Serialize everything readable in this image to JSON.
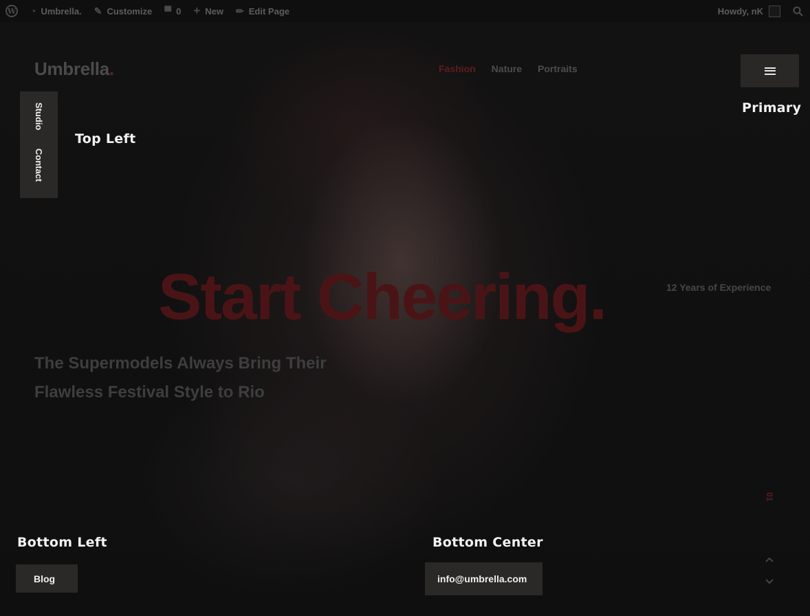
{
  "adminbar": {
    "wp_icon": "wordpress-icon",
    "site_name": "Umbrella.",
    "customize": "Customize",
    "comments_count": "0",
    "new": "New",
    "edit_page": "Edit Page",
    "howdy": "Howdy, nK"
  },
  "header": {
    "logo_text": "Umbrella",
    "logo_dot": ".",
    "nav": [
      "Fashion",
      "Nature",
      "Portraits"
    ],
    "menu_icon": "hamburger-icon"
  },
  "widgets": {
    "primary": "Primary",
    "top_left": "Top Left",
    "bottom_left": "Bottom Left",
    "bottom_center": "Bottom Center"
  },
  "side_menu": [
    "Studio",
    "Contact"
  ],
  "hero": {
    "headline": "Start Cheering.",
    "experience": "12 Years of Experience",
    "subhead": "The Supermodels Always Bring Their Flawless Festival Style to Rio",
    "slide_number": "01"
  },
  "footer": {
    "blog": "Blog",
    "email": "info@umbrella.com",
    "up_icon": "chevron-up-icon",
    "down_icon": "chevron-down-icon"
  },
  "colors": {
    "accent": "#6b1f22",
    "button_bg": "#2b2828"
  }
}
